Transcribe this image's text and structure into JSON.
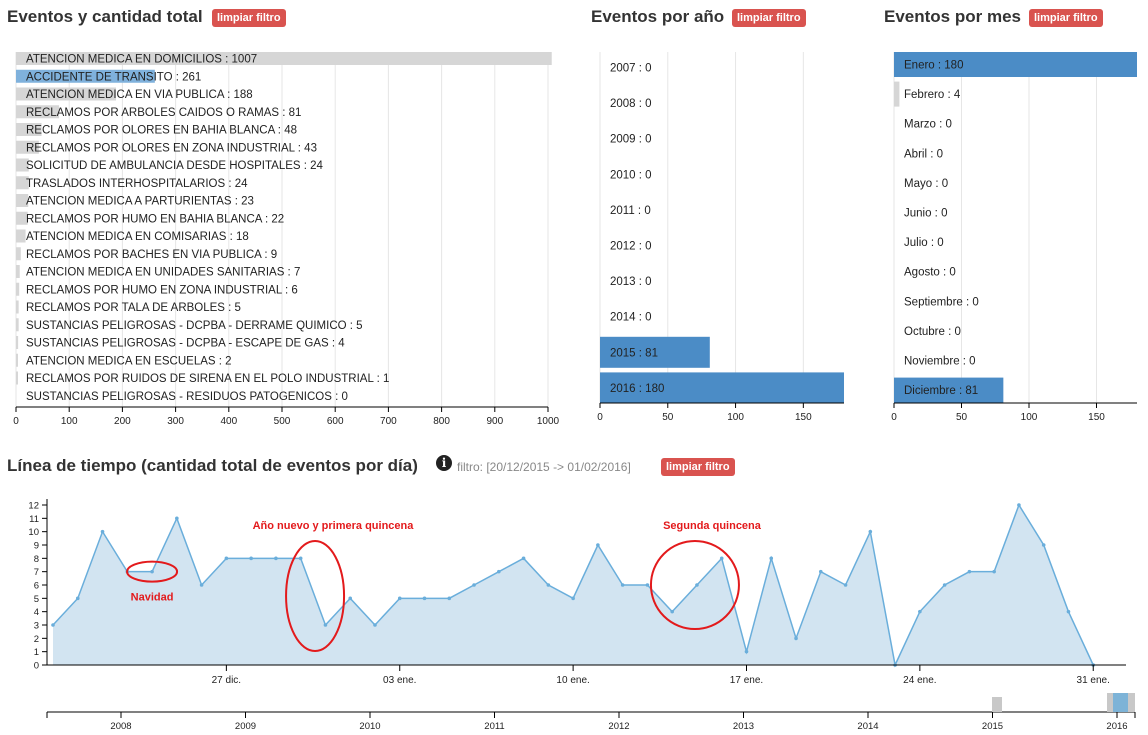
{
  "panels": {
    "tipos": {
      "title": "Eventos y cantidad total",
      "button": "limpiar filtro"
    },
    "anio": {
      "title": "Eventos por año",
      "button": "limpiar filtro"
    },
    "mes": {
      "title": "Eventos por mes",
      "button": "limpiar filtro"
    },
    "timeline": {
      "title": "Línea de tiempo (cantidad total de eventos por día)",
      "filter": "filtro: [20/12/2015 -> 01/02/2016]",
      "button": "limpiar filtro"
    }
  },
  "colors": {
    "bar_grey": "#d6d6d6",
    "bar_blue": "#4b8cc6",
    "selected_blue": "#7fb1dc",
    "area_fill": "#d2e4f1",
    "line": "#6aaedb",
    "annotation": "#e31a1c",
    "button": "#d9534f"
  },
  "chart_data": [
    {
      "type": "bar",
      "orientation": "horizontal",
      "categories": [
        "ATENCION MEDICA EN DOMICILIOS",
        "ACCIDENTE DE TRANSITO",
        "ATENCION MEDICA EN VIA PUBLICA",
        "RECLAMOS POR ARBOLES CAIDOS O RAMAS",
        "RECLAMOS POR OLORES EN BAHIA BLANCA",
        "RECLAMOS POR OLORES EN ZONA INDUSTRIAL",
        "SOLICITUD DE AMBULANCIA DESDE HOSPITALES",
        "TRASLADOS INTERHOSPITALARIOS",
        "ATENCION MEDICA A PARTURIENTAS",
        "RECLAMOS POR HUMO EN BAHIA BLANCA",
        "ATENCION MEDICA EN COMISARIAS",
        "RECLAMOS POR BACHES EN VIA PUBLICA",
        "ATENCION MEDICA EN UNIDADES SANITARIAS",
        "RECLAMOS POR HUMO EN ZONA INDUSTRIAL",
        "RECLAMOS POR TALA DE ARBOLES",
        "SUSTANCIAS PELIGROSAS - DCPBA - DERRAME QUIMICO",
        "SUSTANCIAS PELIGROSAS - DCPBA - ESCAPE DE GAS",
        "ATENCION MEDICA EN ESCUELAS",
        "RECLAMOS POR RUIDOS DE SIRENA EN EL POLO INDUSTRIAL",
        "SUSTANCIAS PELIGROSAS - RESIDUOS PATOGENICOS"
      ],
      "values": [
        1007,
        261,
        188,
        81,
        48,
        43,
        24,
        24,
        23,
        22,
        18,
        9,
        7,
        6,
        5,
        5,
        4,
        2,
        1,
        0
      ],
      "selected": [
        "ACCIDENTE DE TRANSITO"
      ],
      "xlim": [
        0,
        1000
      ],
      "xticks": [
        0,
        100,
        200,
        300,
        400,
        500,
        600,
        700,
        800,
        900,
        1000
      ]
    },
    {
      "type": "bar",
      "orientation": "horizontal",
      "categories": [
        "2007",
        "2008",
        "2009",
        "2010",
        "2011",
        "2012",
        "2013",
        "2014",
        "2015",
        "2016"
      ],
      "values": [
        0,
        0,
        0,
        0,
        0,
        0,
        0,
        0,
        81,
        180
      ],
      "xlim": [
        0,
        180
      ],
      "xticks": [
        0,
        50,
        100,
        150
      ]
    },
    {
      "type": "bar",
      "orientation": "horizontal",
      "categories": [
        "Enero",
        "Febrero",
        "Marzo",
        "Abril",
        "Mayo",
        "Junio",
        "Julio",
        "Agosto",
        "Septiembre",
        "Octubre",
        "Noviembre",
        "Diciembre"
      ],
      "values": [
        180,
        4,
        0,
        0,
        0,
        0,
        0,
        0,
        0,
        0,
        0,
        81
      ],
      "xlim": [
        0,
        180
      ],
      "xticks": [
        0,
        50,
        100,
        150
      ]
    },
    {
      "type": "area",
      "ylim": [
        0,
        12
      ],
      "yticks": [
        0,
        1,
        2,
        3,
        4,
        5,
        6,
        7,
        8,
        9,
        10,
        11,
        12
      ],
      "x": [
        "2015-12-20",
        "2015-12-21",
        "2015-12-22",
        "2015-12-23",
        "2015-12-24",
        "2015-12-25",
        "2015-12-26",
        "2015-12-27",
        "2015-12-28",
        "2015-12-29",
        "2015-12-30",
        "2015-12-31",
        "2016-01-01",
        "2016-01-02",
        "2016-01-03",
        "2016-01-04",
        "2016-01-05",
        "2016-01-06",
        "2016-01-07",
        "2016-01-08",
        "2016-01-09",
        "2016-01-10",
        "2016-01-11",
        "2016-01-12",
        "2016-01-13",
        "2016-01-14",
        "2016-01-15",
        "2016-01-16",
        "2016-01-17",
        "2016-01-18",
        "2016-01-19",
        "2016-01-20",
        "2016-01-21",
        "2016-01-22",
        "2016-01-23",
        "2016-01-24",
        "2016-01-25",
        "2016-01-26",
        "2016-01-27",
        "2016-01-28",
        "2016-01-29",
        "2016-01-30",
        "2016-01-31",
        "2016-02-01"
      ],
      "values": [
        3,
        5,
        10,
        7,
        7,
        11,
        6,
        8,
        8,
        8,
        8,
        3,
        5,
        3,
        5,
        5,
        5,
        6,
        7,
        8,
        6,
        5,
        9,
        6,
        6,
        4,
        6,
        8,
        1,
        8,
        2,
        7,
        6,
        10,
        0,
        4,
        6,
        7,
        7,
        12,
        9,
        4,
        0
      ],
      "xtick_labels": [
        {
          "x": "2015-12-27",
          "label": "27 dic."
        },
        {
          "x": "2016-01-03",
          "label": "03 ene."
        },
        {
          "x": "2016-01-10",
          "label": "10 ene."
        },
        {
          "x": "2016-01-17",
          "label": "17 ene."
        },
        {
          "x": "2016-01-24",
          "label": "24 ene."
        },
        {
          "x": "2016-01-31",
          "label": "31 ene."
        }
      ],
      "annotations": [
        {
          "text": "Navidad"
        },
        {
          "text": "Año nuevo y primera quincena"
        },
        {
          "text": "Segunda quincena"
        }
      ],
      "overview_ticks": [
        "2008",
        "2009",
        "2010",
        "2011",
        "2012",
        "2013",
        "2014",
        "2015",
        "2016"
      ]
    }
  ]
}
